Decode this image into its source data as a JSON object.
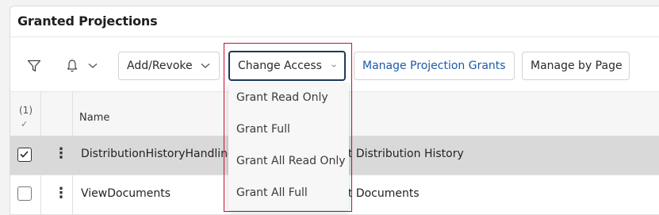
{
  "panel": {
    "title": "Granted Projections"
  },
  "toolbar": {
    "filter_icon": "filter-icon",
    "notification_icon": "bell-icon",
    "add_revoke_label": "Add/Revoke",
    "change_access_label": "Change Access",
    "manage_projection_grants_label": "Manage Projection Grants",
    "manage_by_page_label": "Manage by Page"
  },
  "grid": {
    "selected_count": "(1)",
    "columns": {
      "name": "Name"
    },
    "rows": [
      {
        "name": "DistributionHistoryHandling",
        "description": "nt Distribution History",
        "selected": true
      },
      {
        "name": "ViewDocuments",
        "description": "nt Documents",
        "selected": false
      }
    ]
  },
  "dropdown": {
    "items": [
      "Grant Read Only",
      "Grant Full",
      "Grant All Read Only",
      "Grant All Full"
    ]
  },
  "colors": {
    "link": "#1e5aa8",
    "focus_border": "#1c3a5b",
    "highlight": "#c8102e",
    "selected_row": "#d9d9d9"
  }
}
